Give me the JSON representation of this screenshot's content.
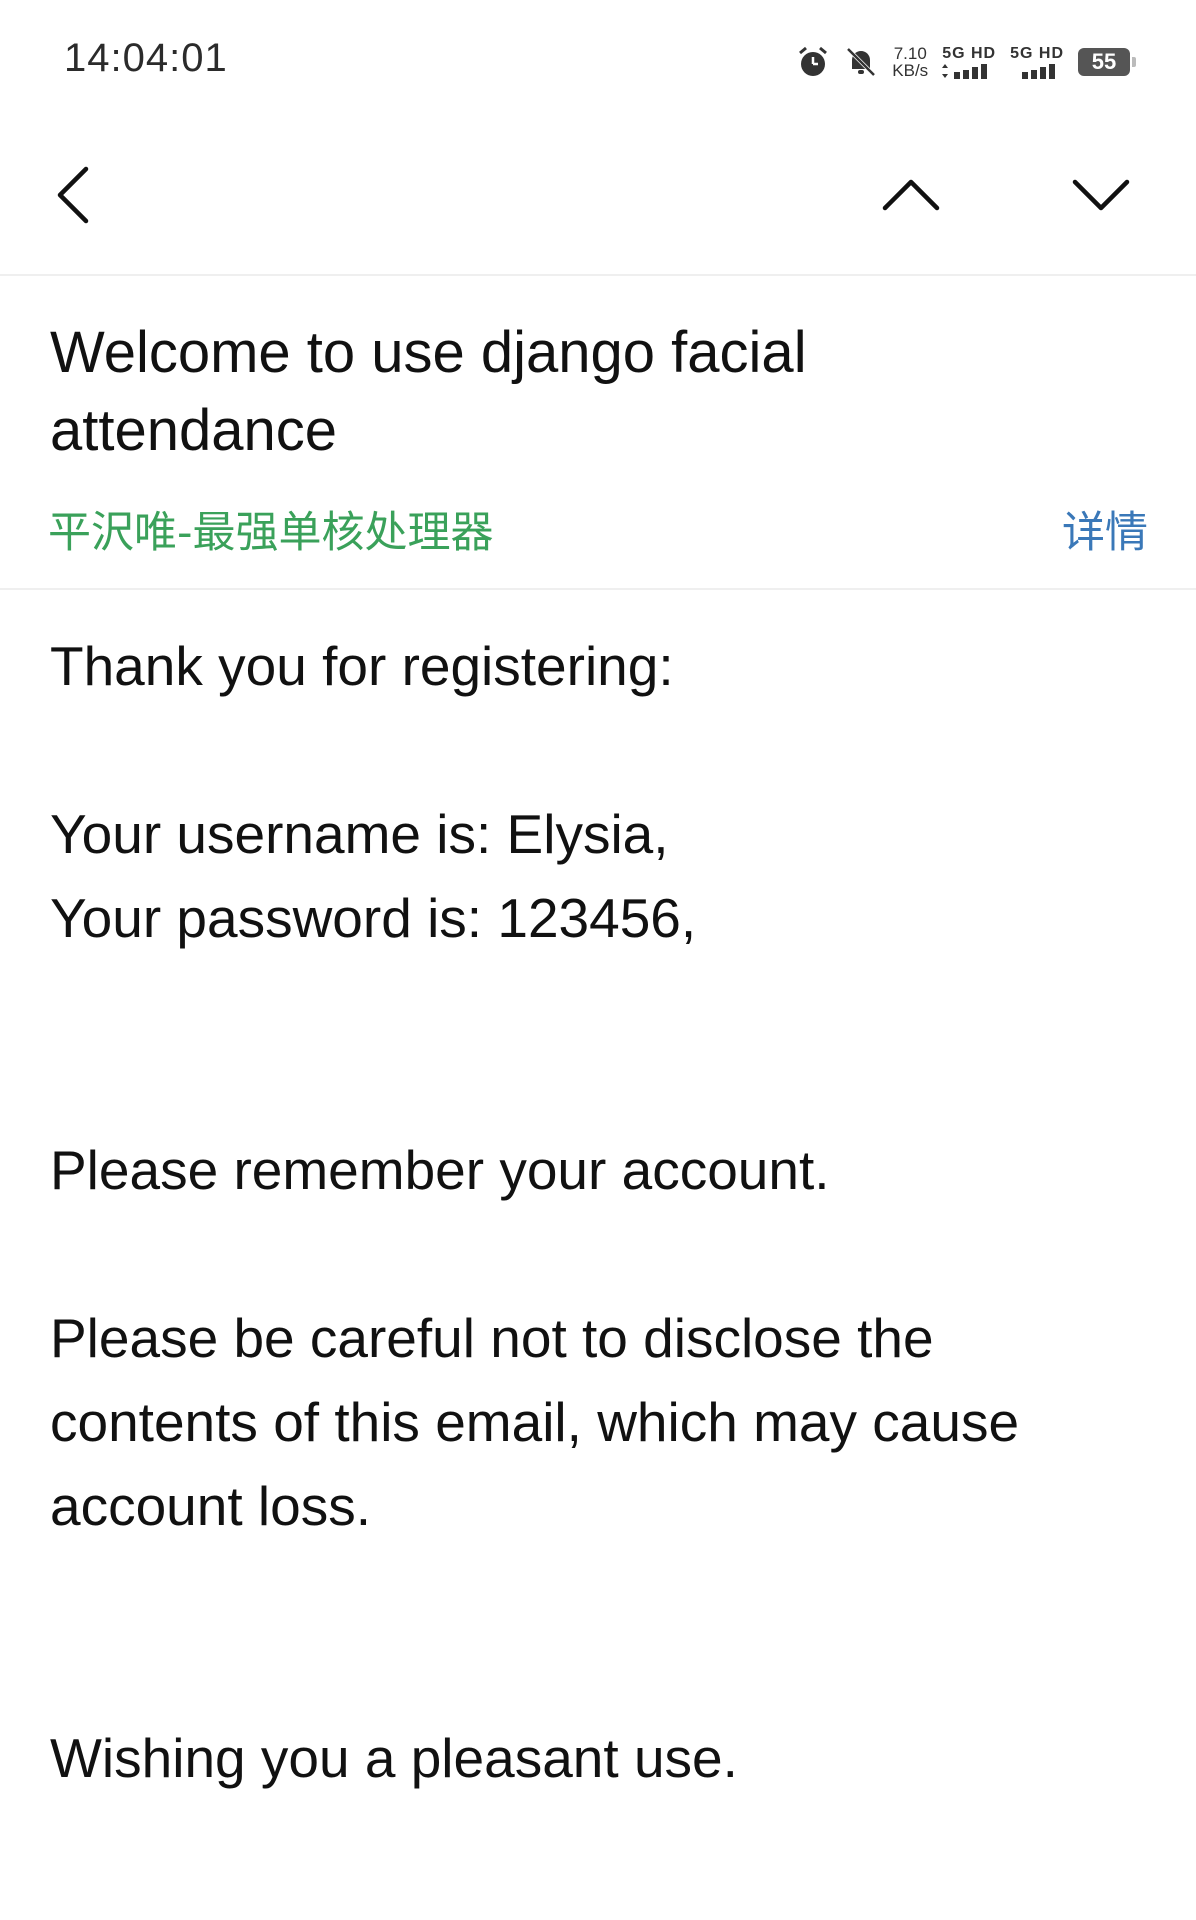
{
  "status_bar": {
    "time": "14:04:01",
    "net_speed_value": "7.10",
    "net_speed_unit": "KB/s",
    "sim1_label": "5G HD",
    "sim2_label": "5G HD",
    "battery_level": "55",
    "icons": [
      "alarm-icon",
      "bell-muted-icon",
      "signal-icon",
      "battery-icon"
    ]
  },
  "nav": {
    "icons": [
      "chevron-left-icon",
      "chevron-up-icon",
      "chevron-down-icon"
    ]
  },
  "email": {
    "subject": "Welcome to use django facial attendance",
    "sender": "平沢唯-最强单核处理器",
    "details_label": "详情",
    "body": {
      "line1": "Thank you for registering:",
      "line2": "Your username is: Elysia,",
      "line3": "Your password is: 123456,",
      "line4": "Please remember your account.",
      "line5": "Please be careful not to disclose the",
      "line6": "contents of this email, which may cause",
      "line7": "account loss.",
      "line8": "Wishing you a pleasant use."
    }
  },
  "colors": {
    "sender": "#3aa15a",
    "details_link": "#3a78b8",
    "divider": "#efefef"
  }
}
